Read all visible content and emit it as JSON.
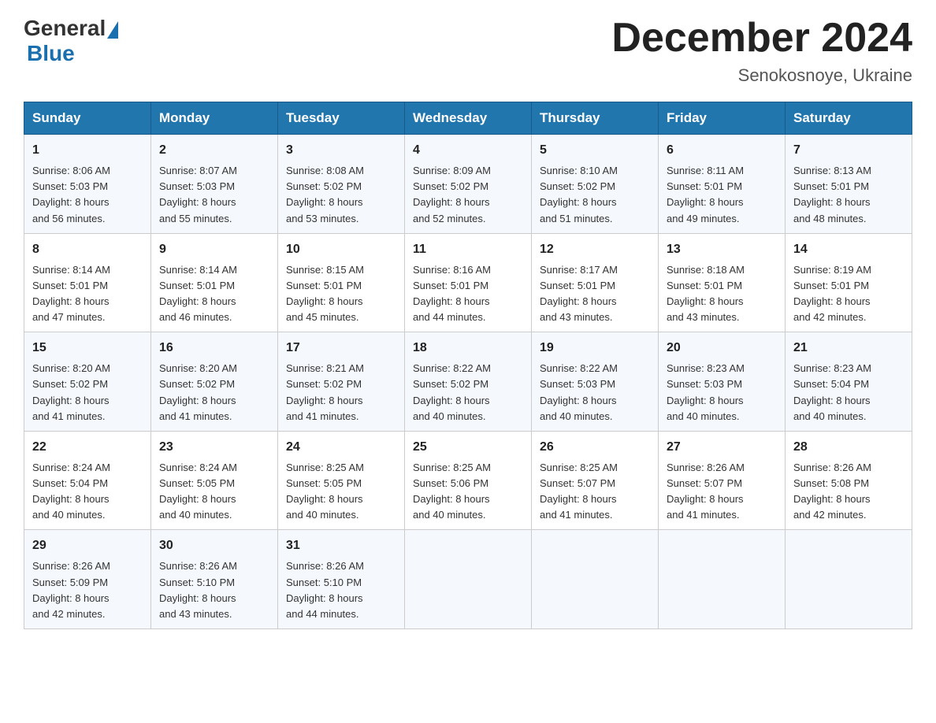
{
  "logo": {
    "general": "General",
    "blue": "Blue"
  },
  "header": {
    "month_year": "December 2024",
    "location": "Senokosnoye, Ukraine"
  },
  "days_of_week": [
    "Sunday",
    "Monday",
    "Tuesday",
    "Wednesday",
    "Thursday",
    "Friday",
    "Saturday"
  ],
  "weeks": [
    [
      {
        "day": "1",
        "sunrise": "8:06 AM",
        "sunset": "5:03 PM",
        "daylight": "8 hours and 56 minutes."
      },
      {
        "day": "2",
        "sunrise": "8:07 AM",
        "sunset": "5:03 PM",
        "daylight": "8 hours and 55 minutes."
      },
      {
        "day": "3",
        "sunrise": "8:08 AM",
        "sunset": "5:02 PM",
        "daylight": "8 hours and 53 minutes."
      },
      {
        "day": "4",
        "sunrise": "8:09 AM",
        "sunset": "5:02 PM",
        "daylight": "8 hours and 52 minutes."
      },
      {
        "day": "5",
        "sunrise": "8:10 AM",
        "sunset": "5:02 PM",
        "daylight": "8 hours and 51 minutes."
      },
      {
        "day": "6",
        "sunrise": "8:11 AM",
        "sunset": "5:01 PM",
        "daylight": "8 hours and 49 minutes."
      },
      {
        "day": "7",
        "sunrise": "8:13 AM",
        "sunset": "5:01 PM",
        "daylight": "8 hours and 48 minutes."
      }
    ],
    [
      {
        "day": "8",
        "sunrise": "8:14 AM",
        "sunset": "5:01 PM",
        "daylight": "8 hours and 47 minutes."
      },
      {
        "day": "9",
        "sunrise": "8:14 AM",
        "sunset": "5:01 PM",
        "daylight": "8 hours and 46 minutes."
      },
      {
        "day": "10",
        "sunrise": "8:15 AM",
        "sunset": "5:01 PM",
        "daylight": "8 hours and 45 minutes."
      },
      {
        "day": "11",
        "sunrise": "8:16 AM",
        "sunset": "5:01 PM",
        "daylight": "8 hours and 44 minutes."
      },
      {
        "day": "12",
        "sunrise": "8:17 AM",
        "sunset": "5:01 PM",
        "daylight": "8 hours and 43 minutes."
      },
      {
        "day": "13",
        "sunrise": "8:18 AM",
        "sunset": "5:01 PM",
        "daylight": "8 hours and 43 minutes."
      },
      {
        "day": "14",
        "sunrise": "8:19 AM",
        "sunset": "5:01 PM",
        "daylight": "8 hours and 42 minutes."
      }
    ],
    [
      {
        "day": "15",
        "sunrise": "8:20 AM",
        "sunset": "5:02 PM",
        "daylight": "8 hours and 41 minutes."
      },
      {
        "day": "16",
        "sunrise": "8:20 AM",
        "sunset": "5:02 PM",
        "daylight": "8 hours and 41 minutes."
      },
      {
        "day": "17",
        "sunrise": "8:21 AM",
        "sunset": "5:02 PM",
        "daylight": "8 hours and 41 minutes."
      },
      {
        "day": "18",
        "sunrise": "8:22 AM",
        "sunset": "5:02 PM",
        "daylight": "8 hours and 40 minutes."
      },
      {
        "day": "19",
        "sunrise": "8:22 AM",
        "sunset": "5:03 PM",
        "daylight": "8 hours and 40 minutes."
      },
      {
        "day": "20",
        "sunrise": "8:23 AM",
        "sunset": "5:03 PM",
        "daylight": "8 hours and 40 minutes."
      },
      {
        "day": "21",
        "sunrise": "8:23 AM",
        "sunset": "5:04 PM",
        "daylight": "8 hours and 40 minutes."
      }
    ],
    [
      {
        "day": "22",
        "sunrise": "8:24 AM",
        "sunset": "5:04 PM",
        "daylight": "8 hours and 40 minutes."
      },
      {
        "day": "23",
        "sunrise": "8:24 AM",
        "sunset": "5:05 PM",
        "daylight": "8 hours and 40 minutes."
      },
      {
        "day": "24",
        "sunrise": "8:25 AM",
        "sunset": "5:05 PM",
        "daylight": "8 hours and 40 minutes."
      },
      {
        "day": "25",
        "sunrise": "8:25 AM",
        "sunset": "5:06 PM",
        "daylight": "8 hours and 40 minutes."
      },
      {
        "day": "26",
        "sunrise": "8:25 AM",
        "sunset": "5:07 PM",
        "daylight": "8 hours and 41 minutes."
      },
      {
        "day": "27",
        "sunrise": "8:26 AM",
        "sunset": "5:07 PM",
        "daylight": "8 hours and 41 minutes."
      },
      {
        "day": "28",
        "sunrise": "8:26 AM",
        "sunset": "5:08 PM",
        "daylight": "8 hours and 42 minutes."
      }
    ],
    [
      {
        "day": "29",
        "sunrise": "8:26 AM",
        "sunset": "5:09 PM",
        "daylight": "8 hours and 42 minutes."
      },
      {
        "day": "30",
        "sunrise": "8:26 AM",
        "sunset": "5:10 PM",
        "daylight": "8 hours and 43 minutes."
      },
      {
        "day": "31",
        "sunrise": "8:26 AM",
        "sunset": "5:10 PM",
        "daylight": "8 hours and 44 minutes."
      },
      null,
      null,
      null,
      null
    ]
  ],
  "cell_labels": {
    "sunrise_prefix": "Sunrise: ",
    "sunset_prefix": "Sunset: ",
    "daylight_prefix": "Daylight: "
  }
}
